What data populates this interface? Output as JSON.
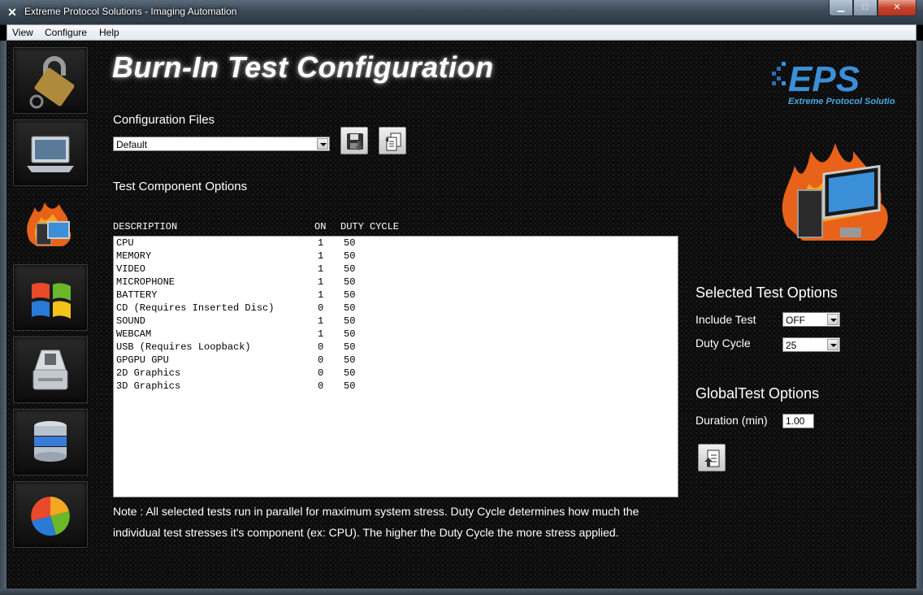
{
  "window": {
    "title": "Extreme Protocol Solutions -  Imaging Automation",
    "buttons": {
      "minimize": "▁",
      "maximize": "□",
      "close": "✕"
    }
  },
  "menu": [
    "View",
    "Configure",
    "Help"
  ],
  "sidebar": [
    {
      "icon": "lock-icon"
    },
    {
      "icon": "laptop-icon"
    },
    {
      "icon": "burn-in-icon",
      "active": true
    },
    {
      "icon": "windows-logo-icon"
    },
    {
      "icon": "hard-drive-icon"
    },
    {
      "icon": "database-icon"
    },
    {
      "icon": "pie-chart-icon"
    }
  ],
  "header": {
    "title": "Burn-In Test Configuration"
  },
  "logo": {
    "letters": "EPS",
    "tagline": "Extreme Protocol Solutions"
  },
  "config": {
    "label": "Configuration Files",
    "selected": "Default",
    "save_icon": "save-icon",
    "copy_icon": "copy-config-icon"
  },
  "tests": {
    "label": "Test Component Options",
    "columns": {
      "description": "DESCRIPTION",
      "on": "ON",
      "duty": "DUTY CYCLE"
    },
    "rows": [
      {
        "description": "CPU",
        "on": "1",
        "duty": "50"
      },
      {
        "description": "MEMORY",
        "on": "1",
        "duty": "50"
      },
      {
        "description": "VIDEO",
        "on": "1",
        "duty": "50"
      },
      {
        "description": "MICROPHONE",
        "on": "1",
        "duty": "50"
      },
      {
        "description": "BATTERY",
        "on": "1",
        "duty": "50"
      },
      {
        "description": "CD (Requires Inserted Disc)",
        "on": "0",
        "duty": "50"
      },
      {
        "description": "SOUND",
        "on": "1",
        "duty": "50"
      },
      {
        "description": "WEBCAM",
        "on": "1",
        "duty": "50"
      },
      {
        "description": "USB (Requires Loopback)",
        "on": "0",
        "duty": "50"
      },
      {
        "description": "GPGPU GPU",
        "on": "0",
        "duty": "50"
      },
      {
        "description": "2D Graphics",
        "on": "0",
        "duty": "50"
      },
      {
        "description": "3D Graphics",
        "on": "0",
        "duty": "50"
      }
    ]
  },
  "selected_options": {
    "heading": "Selected Test Options",
    "include_label": "Include Test",
    "include_value": "OFF",
    "duty_label": "Duty Cycle",
    "duty_value": "25"
  },
  "global_options": {
    "heading": "GlobalTest Options",
    "duration_label": "Duration (min)",
    "duration_value": "1.00",
    "apply_icon": "upload-config-icon"
  },
  "note": {
    "line1": "Note : All selected tests run in parallel for maximum system stress.  Duty Cycle determines how much the",
    "line2": "individual test stresses it's component (ex: CPU).  The higher the Duty Cycle the more stress applied."
  },
  "colors": {
    "accent_blue": "#3a8fd8",
    "flame": "#e8621a",
    "background": "#0b0b0b"
  }
}
